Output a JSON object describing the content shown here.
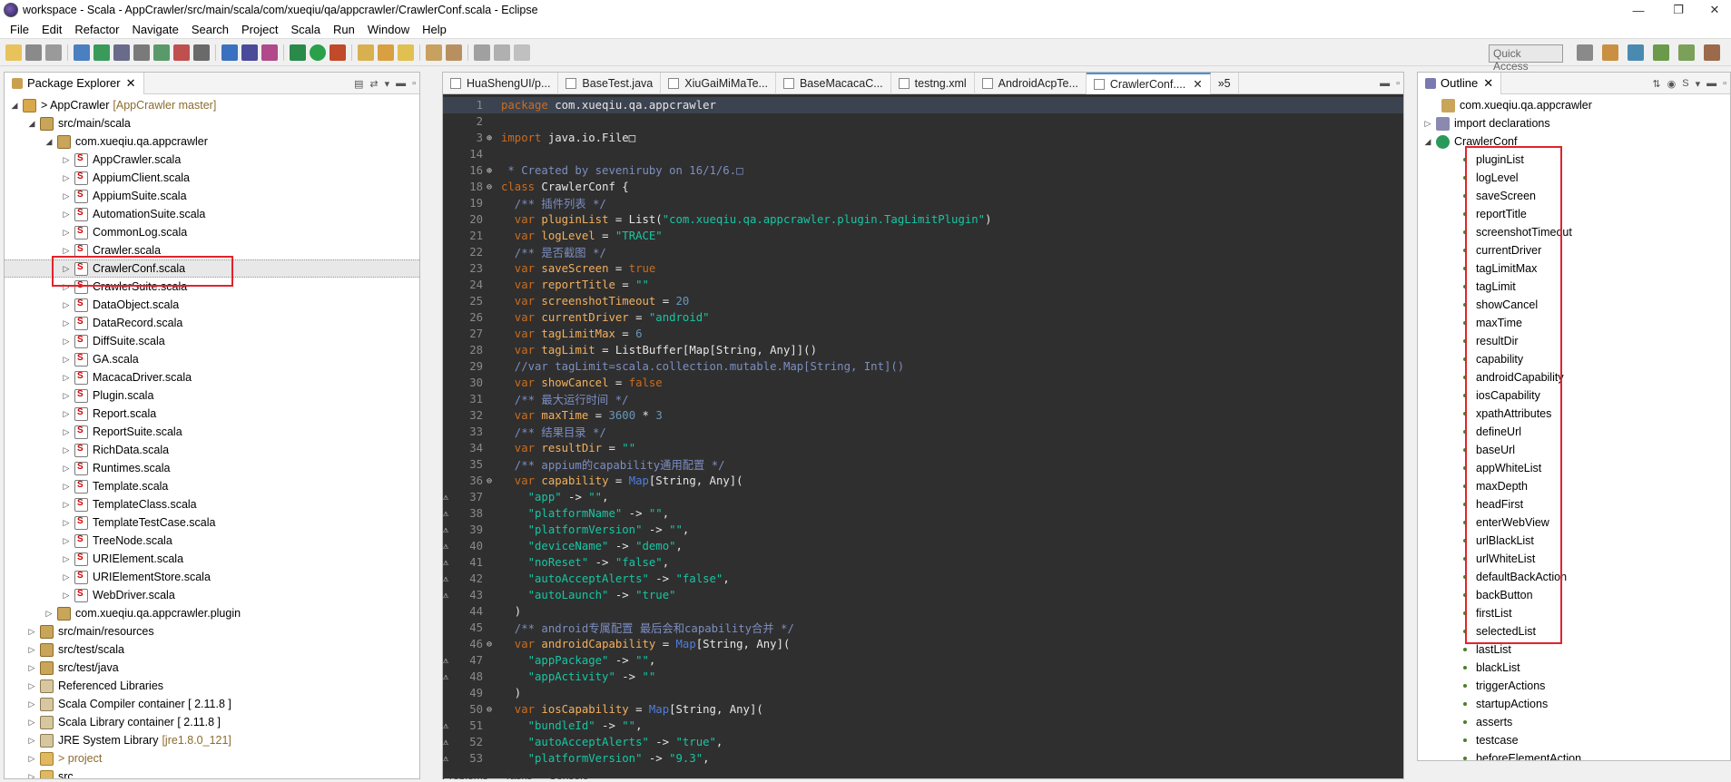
{
  "window": {
    "title": "workspace - Scala - AppCrawler/src/main/scala/com/xueqiu/qa/appcrawler/CrawlerConf.scala - Eclipse",
    "controls": [
      "—",
      "❐",
      "✕"
    ]
  },
  "menu": [
    "File",
    "Edit",
    "Refactor",
    "Navigate",
    "Search",
    "Project",
    "Scala",
    "Run",
    "Window",
    "Help"
  ],
  "quick_access": {
    "placeholder": "Quick Access"
  },
  "package_explorer": {
    "tab_label": "Package Explorer",
    "items": [
      {
        "label": "> AppCrawler",
        "decor": "[AppCrawler master]",
        "level": 0,
        "icon": "project-icon",
        "twisty": "◢"
      },
      {
        "label": "src/main/scala",
        "level": 1,
        "icon": "source-folder-icon",
        "twisty": "◢"
      },
      {
        "label": "com.xueqiu.qa.appcrawler",
        "level": 2,
        "icon": "package-icon",
        "twisty": "◢"
      },
      {
        "label": "AppCrawler.scala",
        "level": 3,
        "icon": "scala-file-icon",
        "twisty": "▷"
      },
      {
        "label": "AppiumClient.scala",
        "level": 3,
        "icon": "scala-file-icon",
        "twisty": "▷"
      },
      {
        "label": "AppiumSuite.scala",
        "level": 3,
        "icon": "scala-file-icon",
        "twisty": "▷"
      },
      {
        "label": "AutomationSuite.scala",
        "level": 3,
        "icon": "scala-file-icon",
        "twisty": "▷"
      },
      {
        "label": "CommonLog.scala",
        "level": 3,
        "icon": "scala-file-icon",
        "twisty": "▷"
      },
      {
        "label": "Crawler.scala",
        "level": 3,
        "icon": "scala-file-icon",
        "twisty": "▷"
      },
      {
        "label": "CrawlerConf.scala",
        "level": 3,
        "icon": "scala-file-icon",
        "twisty": "▷",
        "selected": true
      },
      {
        "label": "CrawlerSuite.scala",
        "level": 3,
        "icon": "scala-file-icon",
        "twisty": "▷"
      },
      {
        "label": "DataObject.scala",
        "level": 3,
        "icon": "scala-file-icon",
        "twisty": "▷"
      },
      {
        "label": "DataRecord.scala",
        "level": 3,
        "icon": "scala-file-icon",
        "twisty": "▷"
      },
      {
        "label": "DiffSuite.scala",
        "level": 3,
        "icon": "scala-file-icon",
        "twisty": "▷"
      },
      {
        "label": "GA.scala",
        "level": 3,
        "icon": "scala-file-icon",
        "twisty": "▷"
      },
      {
        "label": "MacacaDriver.scala",
        "level": 3,
        "icon": "scala-file-icon",
        "twisty": "▷"
      },
      {
        "label": "Plugin.scala",
        "level": 3,
        "icon": "scala-file-icon",
        "twisty": "▷"
      },
      {
        "label": "Report.scala",
        "level": 3,
        "icon": "scala-file-icon",
        "twisty": "▷"
      },
      {
        "label": "ReportSuite.scala",
        "level": 3,
        "icon": "scala-file-icon",
        "twisty": "▷"
      },
      {
        "label": "RichData.scala",
        "level": 3,
        "icon": "scala-file-icon",
        "twisty": "▷"
      },
      {
        "label": "Runtimes.scala",
        "level": 3,
        "icon": "scala-file-icon",
        "twisty": "▷"
      },
      {
        "label": "Template.scala",
        "level": 3,
        "icon": "scala-file-icon",
        "twisty": "▷"
      },
      {
        "label": "TemplateClass.scala",
        "level": 3,
        "icon": "scala-file-icon",
        "twisty": "▷"
      },
      {
        "label": "TemplateTestCase.scala",
        "level": 3,
        "icon": "scala-file-icon",
        "twisty": "▷"
      },
      {
        "label": "TreeNode.scala",
        "level": 3,
        "icon": "scala-file-icon",
        "twisty": "▷"
      },
      {
        "label": "URIElement.scala",
        "level": 3,
        "icon": "scala-file-icon",
        "twisty": "▷"
      },
      {
        "label": "URIElementStore.scala",
        "level": 3,
        "icon": "scala-file-icon",
        "twisty": "▷"
      },
      {
        "label": "WebDriver.scala",
        "level": 3,
        "icon": "scala-file-icon",
        "twisty": "▷"
      },
      {
        "label": "com.xueqiu.qa.appcrawler.plugin",
        "level": 2,
        "icon": "package-icon",
        "twisty": "▷"
      },
      {
        "label": "src/main/resources",
        "level": 1,
        "icon": "source-folder-icon",
        "twisty": "▷"
      },
      {
        "label": "src/test/scala",
        "level": 1,
        "icon": "source-folder-icon",
        "twisty": "▷"
      },
      {
        "label": "src/test/java",
        "level": 1,
        "icon": "source-folder-icon",
        "twisty": "▷"
      },
      {
        "label": "Referenced Libraries",
        "level": 1,
        "icon": "library-icon",
        "twisty": "▷"
      },
      {
        "label": "Scala Compiler container [ 2.11.8 ]",
        "level": 1,
        "icon": "library-icon",
        "twisty": "▷"
      },
      {
        "label": "Scala Library container [ 2.11.8 ]",
        "level": 1,
        "icon": "library-icon",
        "twisty": "▷"
      },
      {
        "label": "JRE System Library",
        "decor": "[jre1.8.0_121]",
        "level": 1,
        "icon": "library-icon",
        "twisty": "▷"
      },
      {
        "label": "> project",
        "level": 1,
        "icon": "folder-icon",
        "twisty": "▷",
        "decor_only": true
      },
      {
        "label": "src",
        "level": 1,
        "icon": "folder-icon",
        "twisty": "▷"
      }
    ]
  },
  "editor": {
    "tabs": [
      {
        "label": "HuaShengUI/p...",
        "active": false
      },
      {
        "label": "BaseTest.java",
        "active": false
      },
      {
        "label": "XiuGaiMiMaTe...",
        "active": false
      },
      {
        "label": "BaseMacacaC...",
        "active": false
      },
      {
        "label": "testng.xml",
        "active": false
      },
      {
        "label": "AndroidAcpTe...",
        "active": false
      },
      {
        "label": "CrawlerConf....",
        "active": true
      }
    ],
    "overflow_label": "»5",
    "lines": [
      {
        "n": "1",
        "tokens": [
          [
            "kw",
            "package"
          ],
          [
            "pl",
            " com.xueqiu.qa.appcrawler"
          ]
        ],
        "highlight": true
      },
      {
        "n": "2",
        "tokens": []
      },
      {
        "n": "3",
        "fold": "⊕",
        "tokens": [
          [
            "kw",
            "import"
          ],
          [
            "pl",
            " java.io.File□"
          ]
        ]
      },
      {
        "n": "14",
        "tokens": []
      },
      {
        "n": "16",
        "fold": "⊕",
        "tokens": [
          [
            "cm",
            " * Created by seveniruby on 16/1/6.□"
          ]
        ]
      },
      {
        "n": "18",
        "fold": "⊖",
        "tokens": [
          [
            "kw",
            "class"
          ],
          [
            "pl",
            " CrawlerConf {"
          ]
        ]
      },
      {
        "n": "19",
        "tokens": [
          [
            "cm",
            "  /** 插件列表 */"
          ]
        ]
      },
      {
        "n": "20",
        "tokens": [
          [
            "kw",
            "  var"
          ],
          [
            "vr",
            " pluginList"
          ],
          [
            "pl",
            " = List("
          ],
          [
            "st",
            "\"com.xueqiu.qa.appcrawler.plugin.TagLimitPlugin\""
          ],
          [
            "pl",
            ")"
          ]
        ]
      },
      {
        "n": "21",
        "tokens": [
          [
            "kw",
            "  var"
          ],
          [
            "vr",
            " logLevel"
          ],
          [
            "pl",
            " = "
          ],
          [
            "st",
            "\"TRACE\""
          ]
        ]
      },
      {
        "n": "22",
        "tokens": [
          [
            "cm",
            "  /** 是否截图 */"
          ]
        ]
      },
      {
        "n": "23",
        "tokens": [
          [
            "kw",
            "  var"
          ],
          [
            "vr",
            " saveScreen"
          ],
          [
            "pl",
            " = "
          ],
          [
            "kw",
            "true"
          ]
        ]
      },
      {
        "n": "24",
        "tokens": [
          [
            "kw",
            "  var"
          ],
          [
            "vr",
            " reportTitle"
          ],
          [
            "pl",
            " = "
          ],
          [
            "st",
            "\"\""
          ]
        ]
      },
      {
        "n": "25",
        "tokens": [
          [
            "kw",
            "  var"
          ],
          [
            "vr",
            " screenshotTimeout"
          ],
          [
            "pl",
            " = "
          ],
          [
            "num",
            "20"
          ]
        ]
      },
      {
        "n": "26",
        "tokens": [
          [
            "kw",
            "  var"
          ],
          [
            "vr",
            " currentDriver"
          ],
          [
            "pl",
            " = "
          ],
          [
            "st",
            "\"android\""
          ]
        ]
      },
      {
        "n": "27",
        "tokens": [
          [
            "kw",
            "  var"
          ],
          [
            "vr",
            " tagLimitMax"
          ],
          [
            "pl",
            " = "
          ],
          [
            "num",
            "6"
          ]
        ]
      },
      {
        "n": "28",
        "tokens": [
          [
            "kw",
            "  var"
          ],
          [
            "vr",
            " tagLimit"
          ],
          [
            "pl",
            " = ListBuffer[Map[String, Any]]()"
          ]
        ]
      },
      {
        "n": "29",
        "tokens": [
          [
            "cm",
            "  //var tagLimit=scala.collection.mutable.Map[String, Int]()"
          ]
        ]
      },
      {
        "n": "30",
        "tokens": [
          [
            "kw",
            "  var"
          ],
          [
            "vr",
            " showCancel"
          ],
          [
            "pl",
            " = "
          ],
          [
            "kw",
            "false"
          ]
        ]
      },
      {
        "n": "31",
        "tokens": [
          [
            "cm",
            "  /** 最大运行时间 */"
          ]
        ]
      },
      {
        "n": "32",
        "tokens": [
          [
            "kw",
            "  var"
          ],
          [
            "vr",
            " maxTime"
          ],
          [
            "pl",
            " = "
          ],
          [
            "num",
            "3600"
          ],
          [
            "pl",
            " * "
          ],
          [
            "num",
            "3"
          ]
        ]
      },
      {
        "n": "33",
        "tokens": [
          [
            "cm",
            "  /** 结果目录 */"
          ]
        ]
      },
      {
        "n": "34",
        "tokens": [
          [
            "kw",
            "  var"
          ],
          [
            "vr",
            " resultDir"
          ],
          [
            "pl",
            " = "
          ],
          [
            "st",
            "\"\""
          ]
        ]
      },
      {
        "n": "35",
        "tokens": [
          [
            "cm",
            "  /** appium的capability通用配置 */"
          ]
        ]
      },
      {
        "n": "36",
        "fold": "⊖",
        "tokens": [
          [
            "kw",
            "  var"
          ],
          [
            "vr",
            " capability"
          ],
          [
            "pl",
            " = "
          ],
          [
            "ty",
            "Map"
          ],
          [
            "pl",
            "[String, Any]("
          ]
        ]
      },
      {
        "n": "37",
        "tokens": [
          [
            "st",
            "    \"app\""
          ],
          [
            "pl",
            " -> "
          ],
          [
            "st",
            "\"\""
          ],
          [
            "pl",
            ","
          ]
        ]
      },
      {
        "n": "38",
        "tokens": [
          [
            "st",
            "    \"platformName\""
          ],
          [
            "pl",
            " -> "
          ],
          [
            "st",
            "\"\""
          ],
          [
            "pl",
            ","
          ]
        ]
      },
      {
        "n": "39",
        "tokens": [
          [
            "st",
            "    \"platformVersion\""
          ],
          [
            "pl",
            " -> "
          ],
          [
            "st",
            "\"\""
          ],
          [
            "pl",
            ","
          ]
        ]
      },
      {
        "n": "40",
        "tokens": [
          [
            "st",
            "    \"deviceName\""
          ],
          [
            "pl",
            " -> "
          ],
          [
            "st",
            "\"demo\""
          ],
          [
            "pl",
            ","
          ]
        ]
      },
      {
        "n": "41",
        "tokens": [
          [
            "st",
            "    \"noReset\""
          ],
          [
            "pl",
            " -> "
          ],
          [
            "st",
            "\"false\""
          ],
          [
            "pl",
            ","
          ]
        ]
      },
      {
        "n": "42",
        "tokens": [
          [
            "st",
            "    \"autoAcceptAlerts\""
          ],
          [
            "pl",
            " -> "
          ],
          [
            "st",
            "\"false\""
          ],
          [
            "pl",
            ","
          ]
        ]
      },
      {
        "n": "43",
        "tokens": [
          [
            "st",
            "    \"autoLaunch\""
          ],
          [
            "pl",
            " -> "
          ],
          [
            "st",
            "\"true\""
          ]
        ]
      },
      {
        "n": "44",
        "tokens": [
          [
            "pl",
            "  )"
          ]
        ]
      },
      {
        "n": "45",
        "tokens": [
          [
            "cm",
            "  /** android专属配置 最后会和capability合并 */"
          ]
        ]
      },
      {
        "n": "46",
        "fold": "⊖",
        "tokens": [
          [
            "kw",
            "  var"
          ],
          [
            "vr",
            " androidCapability"
          ],
          [
            "pl",
            " = "
          ],
          [
            "ty",
            "Map"
          ],
          [
            "pl",
            "[String, Any]("
          ]
        ]
      },
      {
        "n": "47",
        "tokens": [
          [
            "st",
            "    \"appPackage\""
          ],
          [
            "pl",
            " -> "
          ],
          [
            "st",
            "\"\""
          ],
          [
            "pl",
            ","
          ]
        ]
      },
      {
        "n": "48",
        "tokens": [
          [
            "st",
            "    \"appActivity\""
          ],
          [
            "pl",
            " -> "
          ],
          [
            "st",
            "\"\""
          ]
        ]
      },
      {
        "n": "49",
        "tokens": [
          [
            "pl",
            "  )"
          ]
        ]
      },
      {
        "n": "50",
        "fold": "⊖",
        "tokens": [
          [
            "kw",
            "  var"
          ],
          [
            "vr",
            " iosCapability"
          ],
          [
            "pl",
            " = "
          ],
          [
            "ty",
            "Map"
          ],
          [
            "pl",
            "[String, Any]("
          ]
        ]
      },
      {
        "n": "51",
        "tokens": [
          [
            "st",
            "    \"bundleId\""
          ],
          [
            "pl",
            " -> "
          ],
          [
            "st",
            "\"\""
          ],
          [
            "pl",
            ","
          ]
        ]
      },
      {
        "n": "52",
        "tokens": [
          [
            "st",
            "    \"autoAcceptAlerts\""
          ],
          [
            "pl",
            " -> "
          ],
          [
            "st",
            "\"true\""
          ],
          [
            "pl",
            ","
          ]
        ]
      },
      {
        "n": "53",
        "tokens": [
          [
            "st",
            "    \"platformVersion\""
          ],
          [
            "pl",
            " -> "
          ],
          [
            "st",
            "\"9.3\""
          ],
          [
            "pl",
            ","
          ]
        ]
      }
    ],
    "marked_lines": [
      "37",
      "38",
      "39",
      "40",
      "41",
      "42",
      "43",
      "47",
      "48",
      "51",
      "52",
      "53"
    ]
  },
  "outline": {
    "tab_label": "Outline",
    "root_items": [
      {
        "label": "com.xueqiu.qa.appcrawler",
        "icon": "package-icon"
      },
      {
        "label": "import declarations",
        "icon": "import-icon",
        "twisty": "▷"
      },
      {
        "label": "CrawlerConf",
        "icon": "class-icon",
        "twisty": "◢"
      }
    ],
    "members": [
      "pluginList",
      "logLevel",
      "saveScreen",
      "reportTitle",
      "screenshotTimeout",
      "currentDriver",
      "tagLimitMax",
      "tagLimit",
      "showCancel",
      "maxTime",
      "resultDir",
      "capability",
      "androidCapability",
      "iosCapability",
      "xpathAttributes",
      "defineUrl",
      "baseUrl",
      "appWhiteList",
      "maxDepth",
      "headFirst",
      "enterWebView",
      "urlBlackList",
      "urlWhiteList",
      "defaultBackAction",
      "backButton",
      "firstList",
      "selectedList",
      "lastList",
      "blackList",
      "triggerActions",
      "startupActions",
      "asserts",
      "testcase",
      "beforeElementAction"
    ]
  },
  "bottom_tabs": [
    "Problems",
    "Tasks",
    "Console"
  ],
  "colors": {
    "highlight_box": "#e0242c",
    "editor_bg": "#2f2f2f",
    "keyword": "#cc6c1d",
    "string": "#17c6a3",
    "comment": "#7d8ec2"
  }
}
